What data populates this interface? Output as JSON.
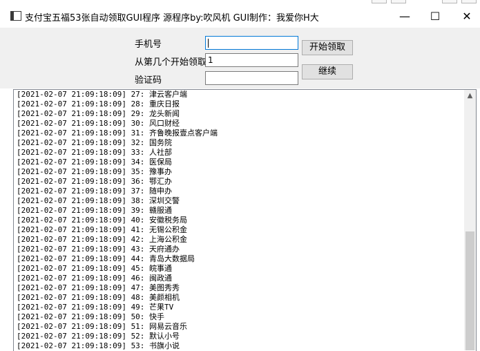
{
  "window": {
    "title": "支付宝五福53张自动领取GUI程序 源程序by:吹风机 GUI制作：我爱你H大",
    "minimize_glyph": "—",
    "maximize_glyph": "☐",
    "close_glyph": "✕"
  },
  "form": {
    "phone_label": "手机号",
    "phone_value": "",
    "start_label": "从第几个开始领取",
    "start_value": "1",
    "code_label": "验证码",
    "code_value": "",
    "start_button": "开始领取",
    "continue_button": "继续"
  },
  "log": {
    "lines": [
      "[2021-02-07 21:09:18:09] 27: 津云客户端",
      "[2021-02-07 21:09:18:09] 28: 重庆日报",
      "[2021-02-07 21:09:18:09] 29: 龙头新闻",
      "[2021-02-07 21:09:18:09] 30: 风口财经",
      "[2021-02-07 21:09:18:09] 31: 齐鲁晚报壹点客户端",
      "[2021-02-07 21:09:18:09] 32: 国务院",
      "[2021-02-07 21:09:18:09] 33: 人社部",
      "[2021-02-07 21:09:18:09] 34: 医保局",
      "[2021-02-07 21:09:18:09] 35: 豫事办",
      "[2021-02-07 21:09:18:09] 36: 鄂汇办",
      "[2021-02-07 21:09:18:09] 37: 随申办",
      "[2021-02-07 21:09:18:09] 38: 深圳交警",
      "[2021-02-07 21:09:18:09] 39: 赣服通",
      "[2021-02-07 21:09:18:09] 40: 安徽税务局",
      "[2021-02-07 21:09:18:09] 41: 无锡公积金",
      "[2021-02-07 21:09:18:09] 42: 上海公积金",
      "[2021-02-07 21:09:18:09] 43: 天府通办",
      "[2021-02-07 21:09:18:09] 44: 青岛大数据局",
      "[2021-02-07 21:09:18:09] 45: 皖事通",
      "[2021-02-07 21:09:18:09] 46: 闽政通",
      "[2021-02-07 21:09:18:09] 47: 美图秀秀",
      "[2021-02-07 21:09:18:09] 48: 美颜相机",
      "[2021-02-07 21:09:18:09] 49: 芒果TV",
      "[2021-02-07 21:09:18:09] 50: 快手",
      "[2021-02-07 21:09:18:09] 51: 网易云音乐",
      "[2021-02-07 21:09:18:09] 52: 默认小号",
      "[2021-02-07 21:09:18:09] 53: 书旗小说"
    ],
    "scroll_up_glyph": "▲"
  }
}
